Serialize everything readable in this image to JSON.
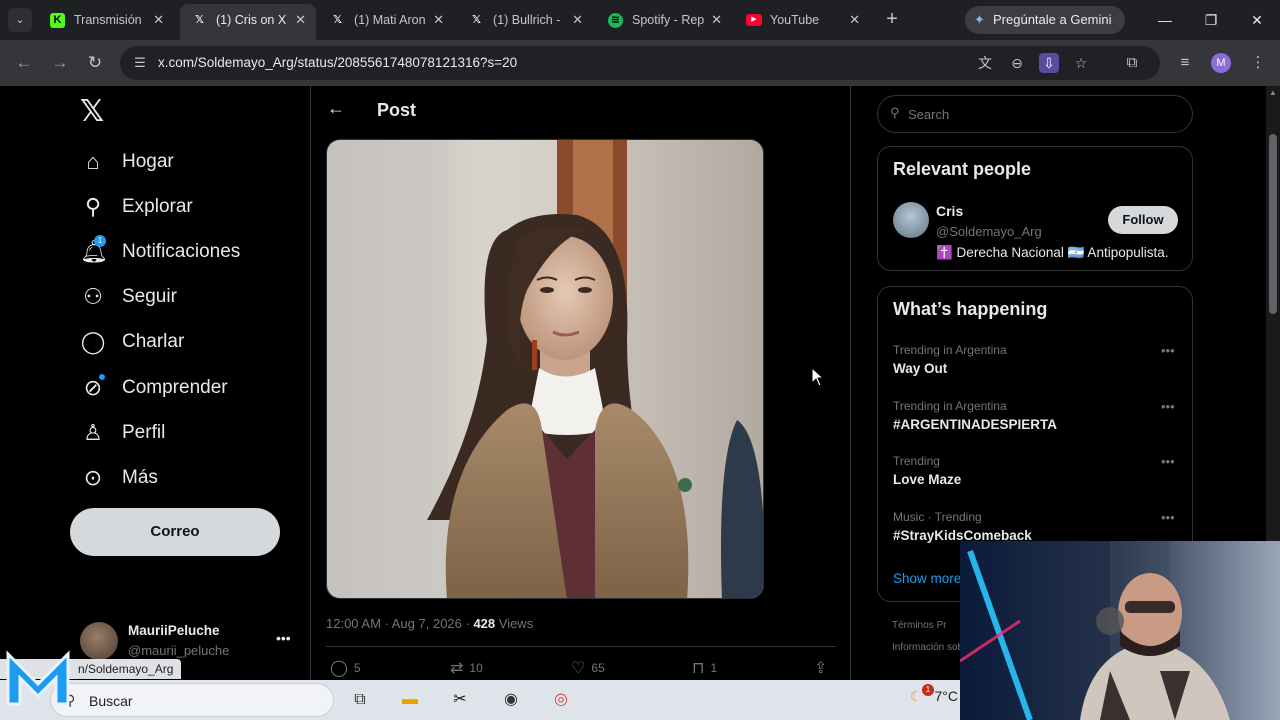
{
  "browser": {
    "tabs": [
      {
        "label": "Transmisión",
        "favicon": "kick-icon",
        "color": "#53fc18",
        "active": false
      },
      {
        "label": "(1) Cris on X",
        "favicon": "x-icon",
        "color": "#ffffff",
        "active": true
      },
      {
        "label": "(1) Mati Aron",
        "favicon": "x-icon",
        "color": "#ffffff",
        "active": false
      },
      {
        "label": "(1) Bullrich -",
        "favicon": "x-icon",
        "color": "#ffffff",
        "active": false
      },
      {
        "label": "Spotify - Rep",
        "favicon": "spotify-icon",
        "color": "#1db954",
        "active": false
      },
      {
        "label": "YouTube",
        "favicon": "youtube-icon",
        "color": "#ff0033",
        "active": false
      }
    ],
    "gemini_label": "Pregúntale a Gemini",
    "url": "x.com/Soldemayo_Arg/status/2085561748078121316?s=20",
    "profile_initial": "M"
  },
  "nav": {
    "items": [
      {
        "label": "Hogar",
        "icon": "home-icon"
      },
      {
        "label": "Explorar",
        "icon": "search-icon"
      },
      {
        "label": "Notificaciones",
        "icon": "bell-icon",
        "badge": "1"
      },
      {
        "label": "Seguir",
        "icon": "follow-icon"
      },
      {
        "label": "Charlar",
        "icon": "chat-icon"
      },
      {
        "label": "Comprender",
        "icon": "grok-icon"
      },
      {
        "label": "Perfil",
        "icon": "profile-icon"
      },
      {
        "label": "Más",
        "icon": "more-icon"
      }
    ],
    "post_button": "Correo",
    "account": {
      "name": "MauriiPeluche",
      "handle": "@maurii_peluche"
    }
  },
  "status_link": "https://x.com/Soldemayo_Arg",
  "status_link_visible": "n/Soldemayo_Arg",
  "post": {
    "header": "Post",
    "time": "12:00 AM · Aug 7, 2026 · ",
    "views_count": "428",
    "views_label": " Views",
    "replies": "5",
    "reposts": "10",
    "likes": "65",
    "bookmarks": "1"
  },
  "sidebar": {
    "search_placeholder": "Search",
    "relevant_title": "Relevant people",
    "person": {
      "name": "Cris",
      "handle": "@Soldemayo_Arg",
      "bio": "✝️ Derecha Nacional 🇦🇷 Antipopulista.",
      "follow_label": "Follow"
    },
    "happening_title": "What’s happening",
    "trends": [
      {
        "context": "Trending in Argentina",
        "name": "Way Out"
      },
      {
        "context": "Trending in Argentina",
        "name": "#ARGENTINADESPIERTA"
      },
      {
        "context": "Trending",
        "name": "Love Maze"
      },
      {
        "context": "Music · Trending",
        "name": "#StrayKidsComeback"
      }
    ],
    "show_more": "Show more",
    "footer1": "Términos   Pr",
    "footer2": "Información sob"
  },
  "taskbar": {
    "search_text": "Buscar",
    "weather": "7°C",
    "weather_badge": "1"
  },
  "colors": {
    "accent": "#1d9bf0",
    "background": "#000000",
    "border": "#2f3336"
  }
}
